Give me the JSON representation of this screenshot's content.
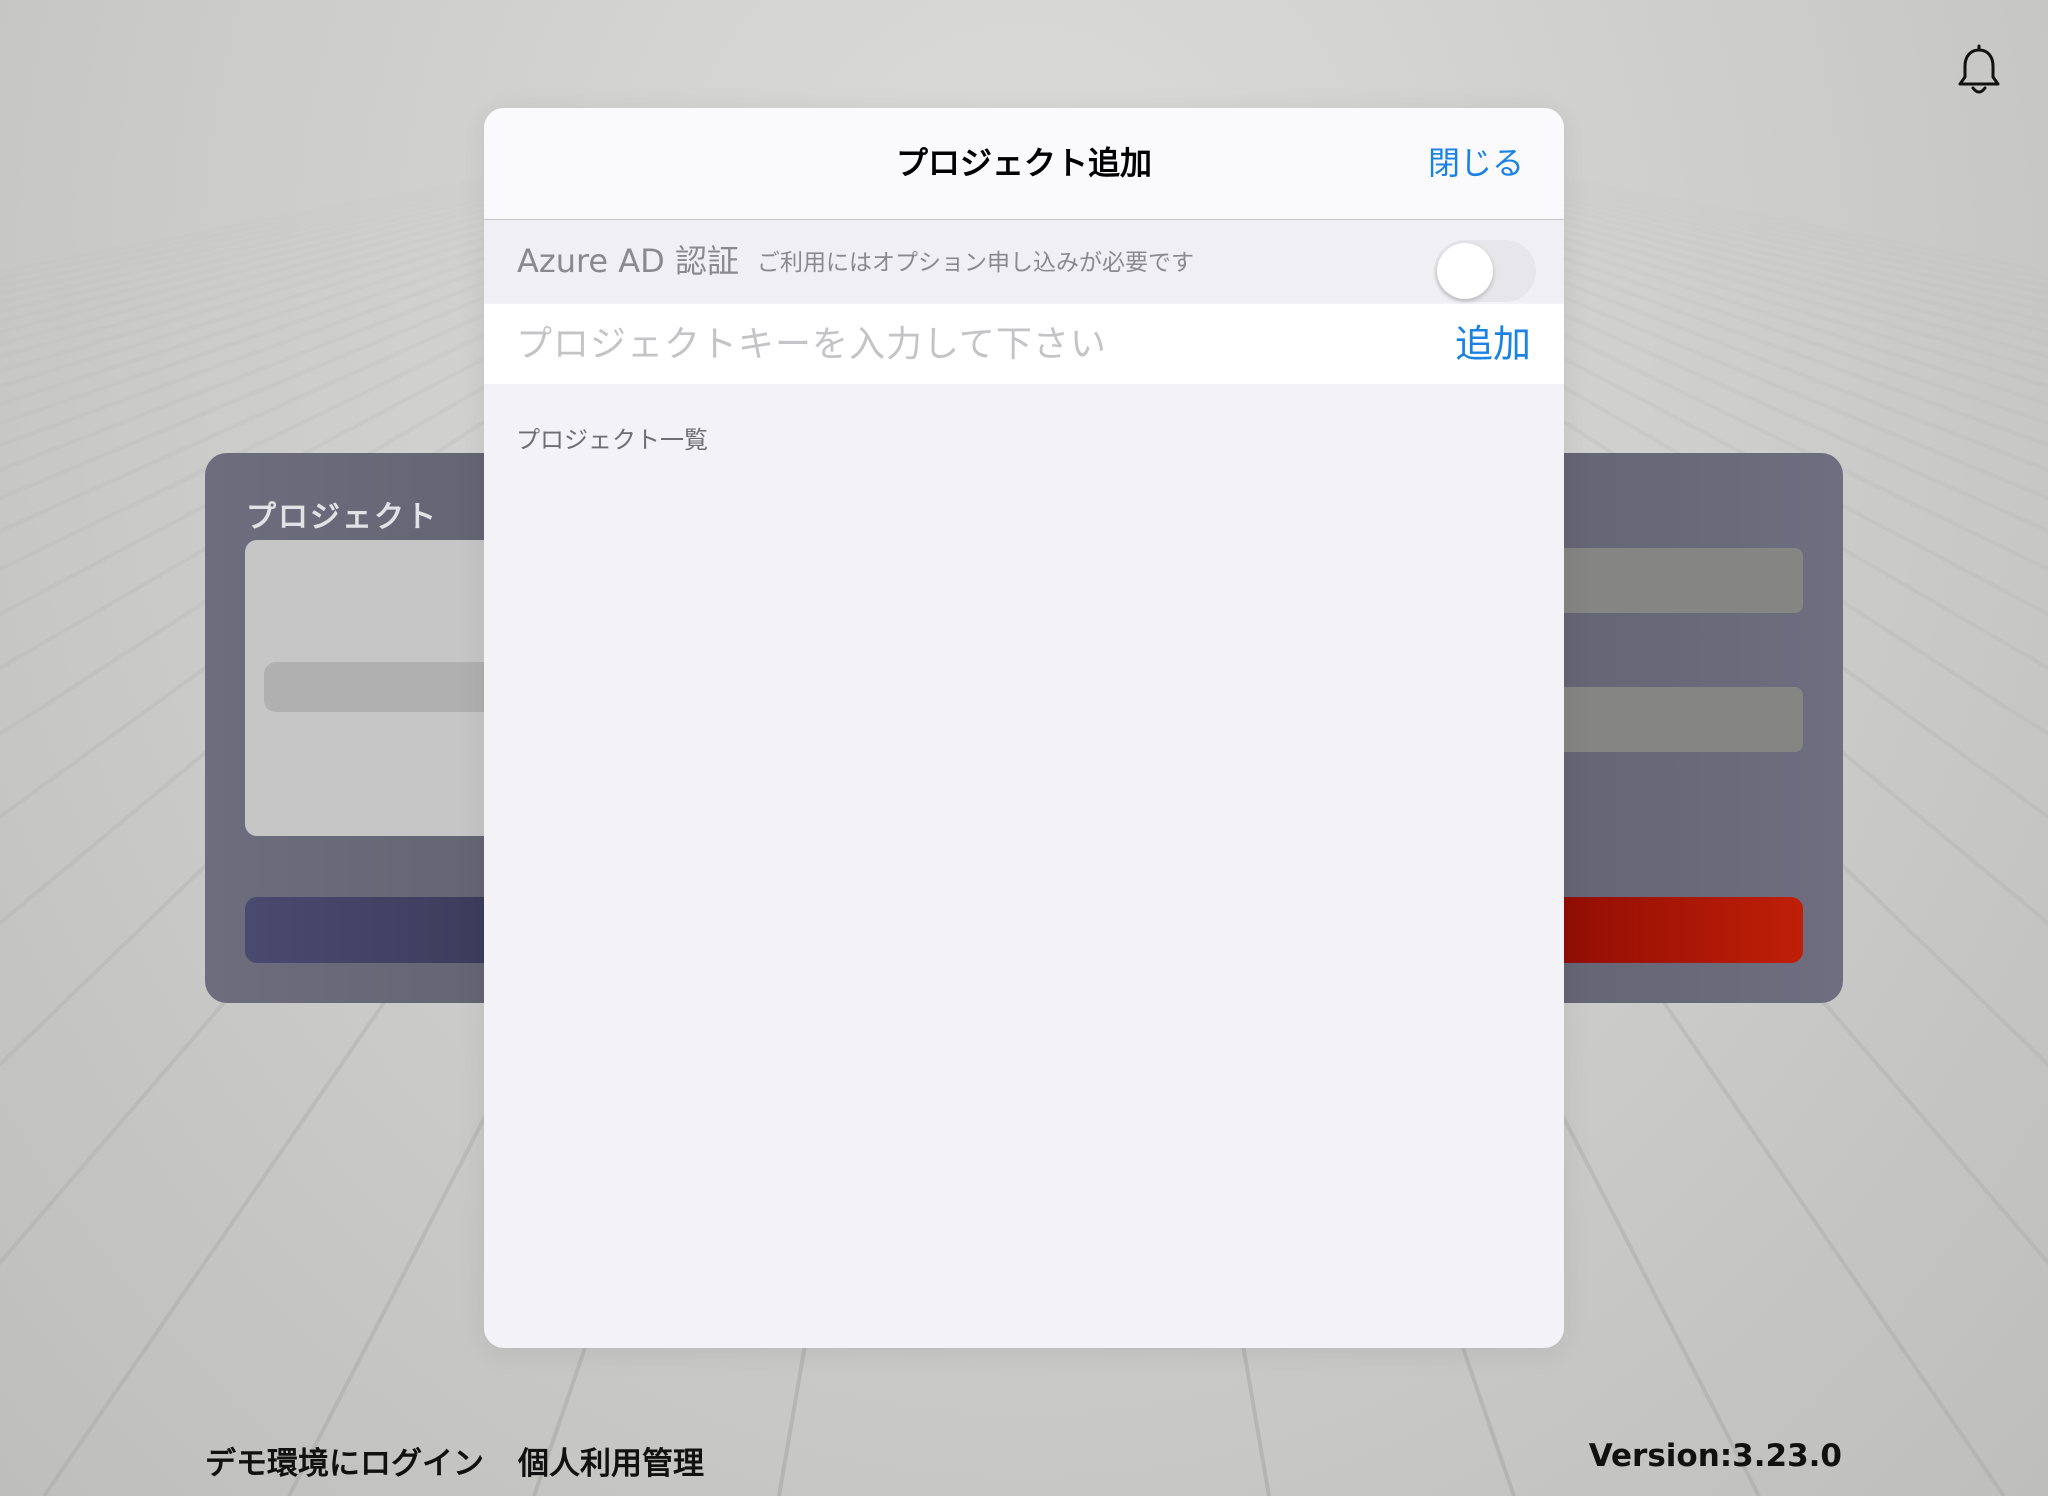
{
  "header": {
    "notification_icon": "bell-icon"
  },
  "background": {
    "card_title": "プロジェクト",
    "accent_colors": {
      "card": "#5e5e6b",
      "left_button": "#40405f",
      "right_button": "#b01805"
    }
  },
  "modal": {
    "title": "プロジェクト追加",
    "close_label": "閉じる",
    "azure": {
      "label": "Azure AD 認証",
      "note": "ご利用にはオプション申し込みが必要です",
      "enabled": false
    },
    "project_key": {
      "value": "",
      "placeholder": "プロジェクトキーを入力して下さい",
      "add_label": "追加"
    },
    "list_header": "プロジェクト一覧",
    "projects": []
  },
  "footer": {
    "demo_login": "デモ環境にログイン",
    "personal_usage": "個人利用管理",
    "version": "Version:3.23.0"
  },
  "colors": {
    "accent": "#1a82e3",
    "modal_bg": "#f2f2f7"
  }
}
